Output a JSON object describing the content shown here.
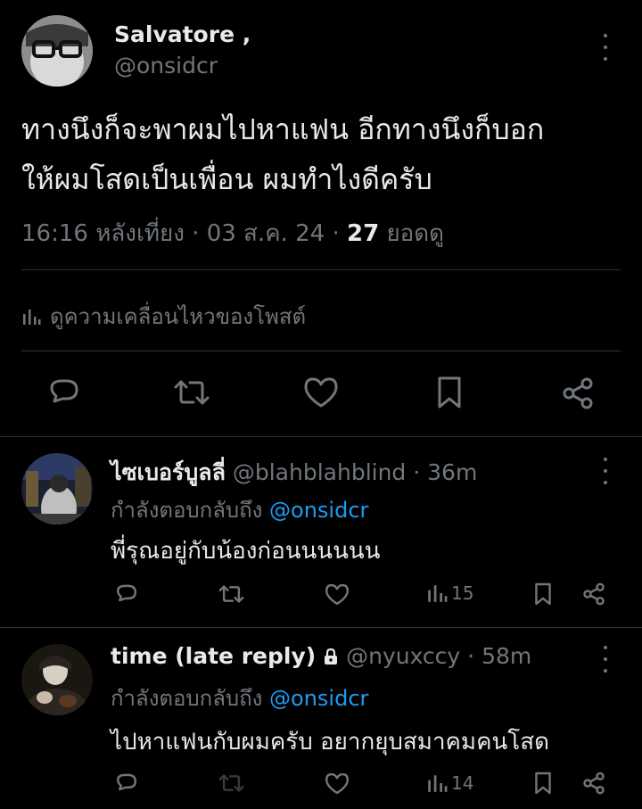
{
  "post": {
    "author_name": "Salvatore ,",
    "author_handle": "@onsidcr",
    "text_line1": "ทางนึงก็จะพาผมไปหาแฟน อีกทางนึงก็บอก",
    "text_line2": "ให้ผมโสดเป็นเพื่อน ผมทำไงดีครับ",
    "time": "16:16 หลังเที่ยง · 03 ส.ค. 24 · ",
    "views_count": "27",
    "views_label": " ยอดดู",
    "engagements_label": "ดูความเคลื่อนไหวของโพสต์"
  },
  "replies": [
    {
      "name": "ไซเบอร์บูลลี่",
      "handle": "@blahblahblind",
      "time": "· 36m",
      "replying_prefix": "กำลังตอบกลับถึง ",
      "replying_to": "@onsidcr",
      "text": "พี่รุณอยู่กับน้องก่อนนนนนน",
      "views": "15"
    },
    {
      "name": "time (late reply)",
      "handle": "@nyuxccy",
      "time": "· 58m",
      "replying_prefix": "กำลังตอบกลับถึง ",
      "replying_to": "@onsidcr",
      "text": "ไปหาแฟนกับผมครับ อยากยุบสมาคมคนโสด",
      "views": "14"
    }
  ],
  "icons": {
    "reply": "reply-icon",
    "repost": "repost-icon",
    "like": "like-icon",
    "bookmark": "bookmark-icon",
    "share": "share-icon",
    "views": "views-icon",
    "lock": "lock-icon",
    "more": "more-icon"
  },
  "colors": {
    "background": "#000000",
    "text": "#e7e9ea",
    "muted": "#71767b",
    "link": "#1d9bf0",
    "divider": "#2f3336"
  }
}
